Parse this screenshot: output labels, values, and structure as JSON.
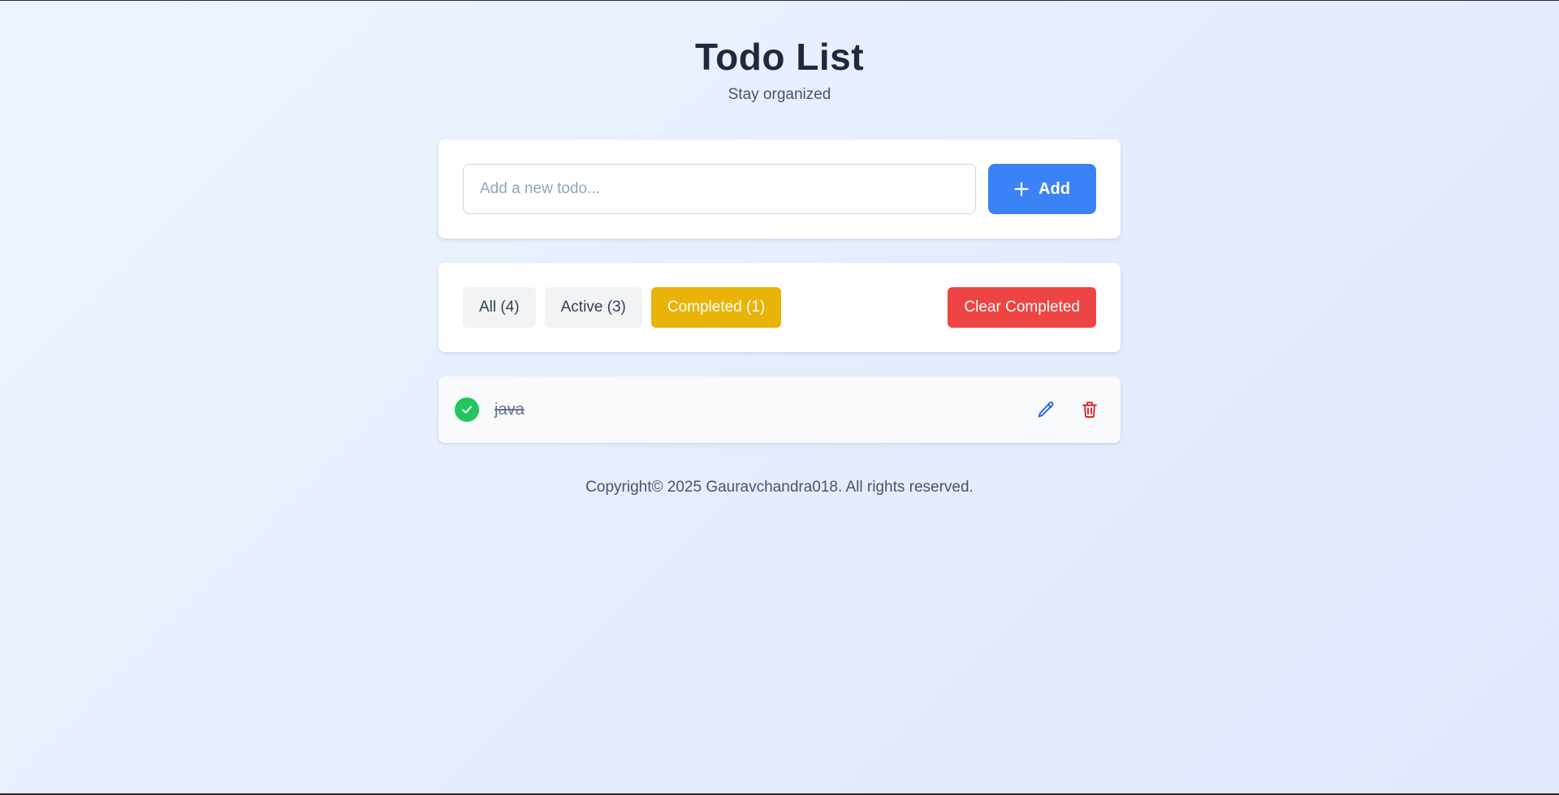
{
  "header": {
    "title": "Todo List",
    "subtitle": "Stay organized"
  },
  "add_form": {
    "input_value": "",
    "input_placeholder": "Add a new todo...",
    "add_label": "Add",
    "add_icon": "plus-icon"
  },
  "filters": {
    "items": [
      {
        "label": "All (4)",
        "active": false
      },
      {
        "label": "Active (3)",
        "active": false
      },
      {
        "label": "Completed (1)",
        "active": true
      }
    ],
    "clear_label": "Clear Completed"
  },
  "todos": [
    {
      "text": "java",
      "completed": true,
      "check_icon": "check-circle-icon",
      "edit_icon": "pencil-icon",
      "delete_icon": "trash-icon"
    }
  ],
  "footer": {
    "text": "Copyright© 2025 Gauravchandra018. All rights reserved."
  },
  "colors": {
    "primary": "#3b82f6",
    "active_filter": "#eab308",
    "danger": "#ef4444",
    "success": "#22c55e",
    "edit_icon": "#2563eb",
    "delete_icon": "#dc2626"
  }
}
